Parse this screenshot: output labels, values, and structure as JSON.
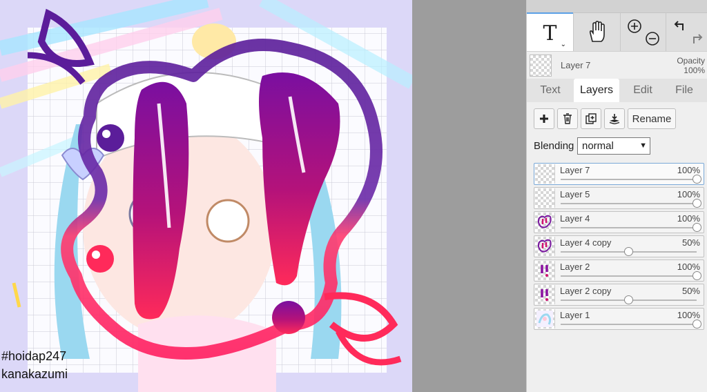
{
  "canvas": {
    "watermark_tag": "#hoidap247",
    "watermark_author": "kanakazumi"
  },
  "tools": {
    "text_glyph": "T",
    "text_icon": "text-tool-icon",
    "hand_icon": "hand-tool-icon",
    "zoom_in_icon": "zoom-in-icon",
    "zoom_out_icon": "zoom-out-icon",
    "undo_icon": "undo-icon",
    "redo_icon": "redo-icon"
  },
  "current_layer": {
    "name": "Layer 7",
    "opacity_label": "Opacity",
    "opacity_value": "100%"
  },
  "tabs": [
    {
      "label": "Text"
    },
    {
      "label": "Layers",
      "active": true
    },
    {
      "label": "Edit"
    },
    {
      "label": "File"
    }
  ],
  "layer_actions": {
    "add_icon": "plus-icon",
    "delete_icon": "trash-icon",
    "duplicate_icon": "duplicate-icon",
    "merge_icon": "merge-down-icon",
    "rename_label": "Rename"
  },
  "blending": {
    "label": "Blending",
    "value": "normal"
  },
  "layers": [
    {
      "name": "Layer 7",
      "opacity": "100%",
      "level": 100,
      "selected": true
    },
    {
      "name": "Layer 5",
      "opacity": "100%",
      "level": 100
    },
    {
      "name": "Layer 4",
      "opacity": "100%",
      "level": 100
    },
    {
      "name": "Layer 4 copy",
      "opacity": "50%",
      "level": 50
    },
    {
      "name": "Layer 2",
      "opacity": "100%",
      "level": 100
    },
    {
      "name": "Layer 2 copy",
      "opacity": "50%",
      "level": 50
    },
    {
      "name": "Layer 1",
      "opacity": "100%",
      "level": 100
    }
  ],
  "colors": {
    "accent": "#5aa0e6",
    "stroke_purple": "#5b1d9a",
    "stroke_pink": "#ff1f60"
  }
}
